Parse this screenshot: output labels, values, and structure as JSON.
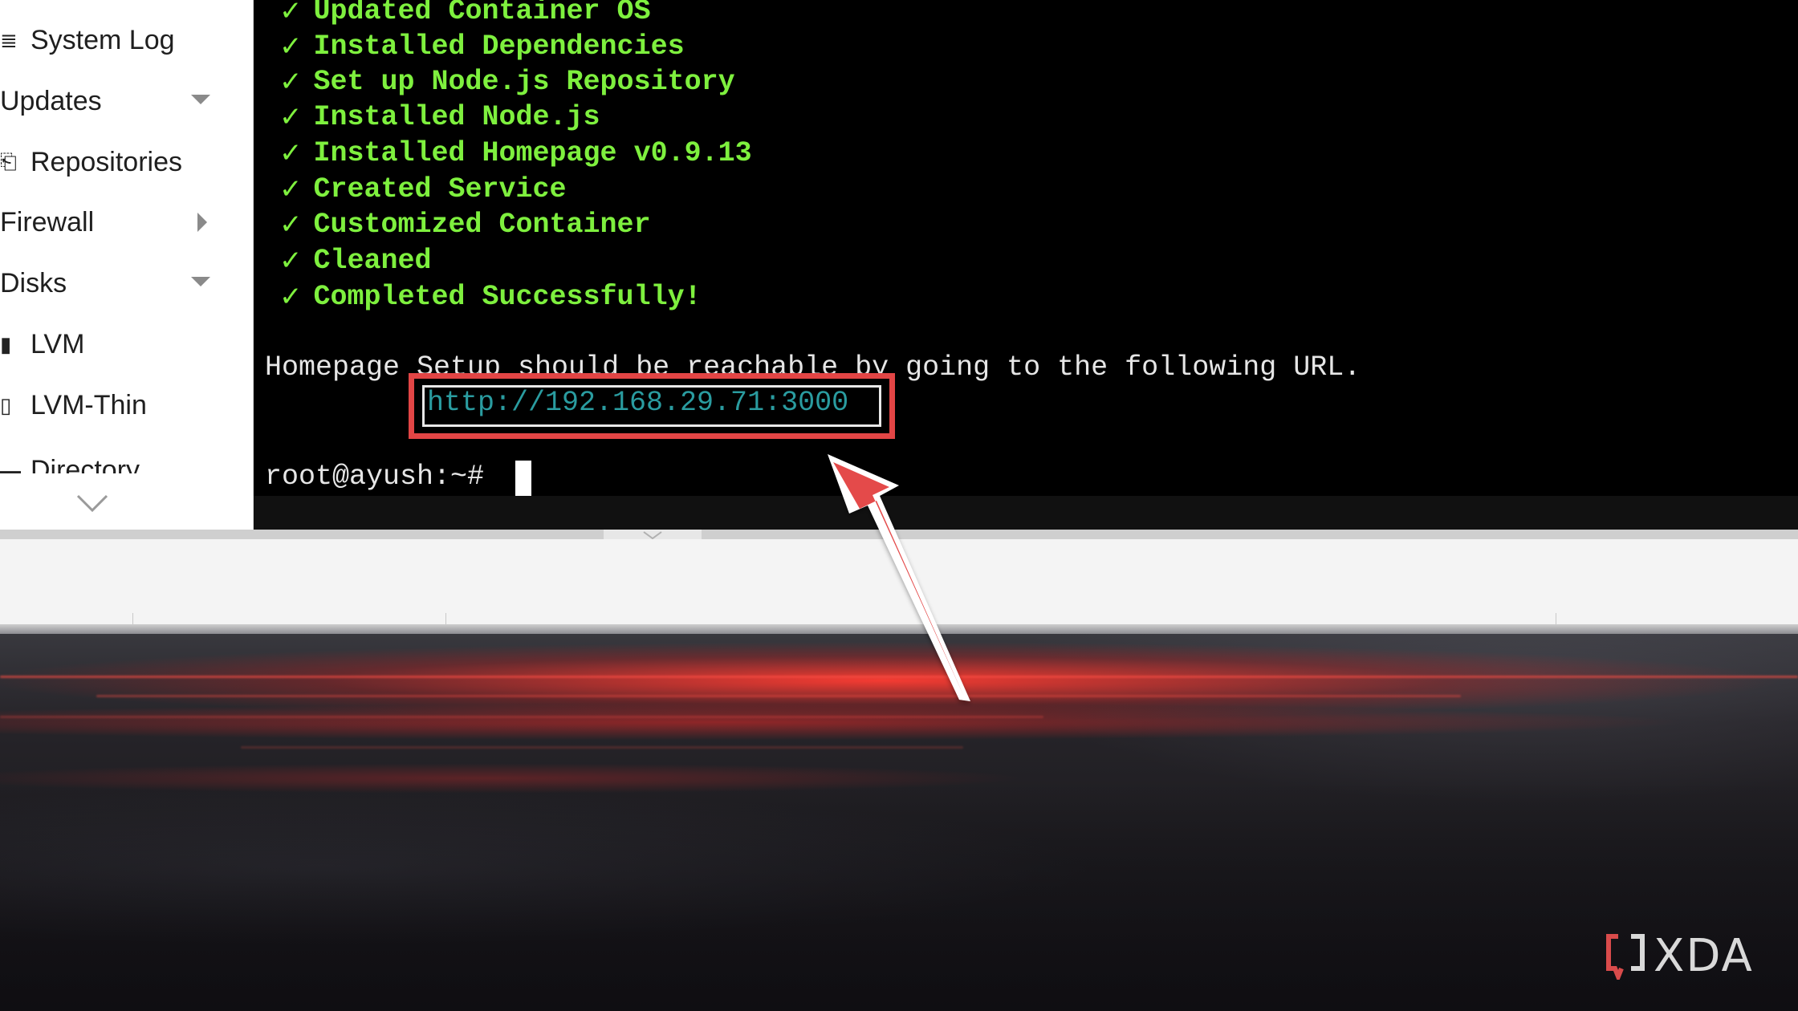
{
  "sidebar": {
    "items": [
      {
        "label": "System Log",
        "icon": "list-icon",
        "caret": ""
      },
      {
        "label": "Updates",
        "icon": "",
        "caret": "down"
      },
      {
        "label": "Repositories",
        "icon": "repository-icon",
        "caret": ""
      },
      {
        "label": "Firewall",
        "icon": "",
        "caret": "right"
      },
      {
        "label": "Disks",
        "icon": "",
        "caret": "down"
      },
      {
        "label": "LVM",
        "icon": "disk-filled-icon",
        "caret": ""
      },
      {
        "label": "LVM-Thin",
        "icon": "disk-outline-icon",
        "caret": ""
      },
      {
        "label": "Directory",
        "icon": "folder-icon",
        "caret": ""
      }
    ]
  },
  "terminal": {
    "check_glyph": "✓",
    "success_lines": [
      "Updated Container OS",
      "Installed Dependencies",
      "Set up Node.js Repository",
      "Installed Node.js",
      "Installed Homepage v0.9.13",
      "Created Service",
      "Customized Container",
      "Cleaned",
      "Completed Successfully!"
    ],
    "message": "Homepage Setup should be reachable by going to the following URL.",
    "url": "http://192.168.29.71:3000",
    "prompt": "root@ayush:~#"
  },
  "watermark": {
    "brand": "XDA"
  },
  "colors": {
    "success_green": "#7ef03e",
    "url_teal": "#2a9ca0",
    "highlight_red": "#e24545"
  }
}
